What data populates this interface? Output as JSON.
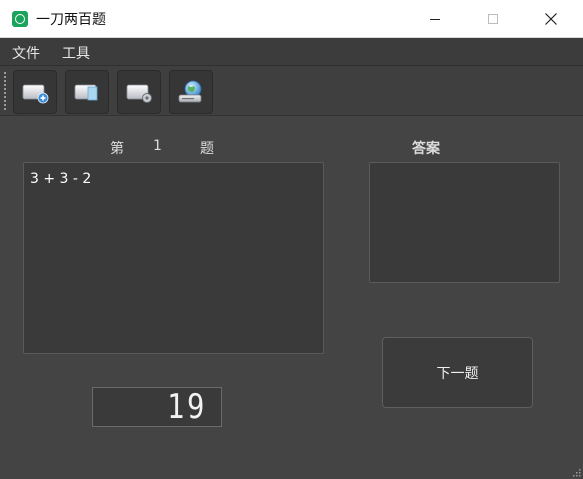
{
  "window": {
    "title": "一刀两百题",
    "icon": "app-icon"
  },
  "menu": {
    "file": "文件",
    "tools": "工具"
  },
  "toolbar": {
    "buttons": [
      {
        "icon": "new-add-icon"
      },
      {
        "icon": "document-icon"
      },
      {
        "icon": "settings-gear-icon"
      },
      {
        "icon": "globe-network-icon"
      }
    ]
  },
  "question": {
    "prefix": "第",
    "number": "1",
    "suffix": "题",
    "text": "3 + 3 - 2"
  },
  "answer": {
    "label": "答案",
    "value": ""
  },
  "next_button": "下一题",
  "counter": "19",
  "colors": {
    "background": "#444444",
    "panel": "#3a3a3a",
    "app_icon": "#1aa35a"
  }
}
